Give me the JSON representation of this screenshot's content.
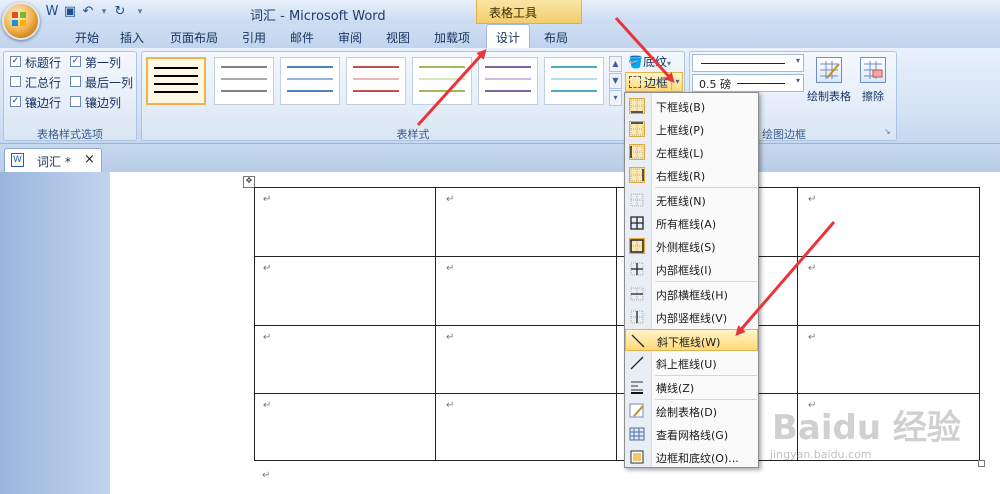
{
  "window": {
    "title": "词汇 - Microsoft Word",
    "context_tab": "表格工具"
  },
  "ribbon_tabs": [
    "开始",
    "插入",
    "页面布局",
    "引用",
    "邮件",
    "审阅",
    "视图",
    "加载项",
    "设计",
    "布局"
  ],
  "active_tab": "设计",
  "table_style_options": {
    "group_title": "表格样式选项",
    "options": [
      {
        "label": "标题行",
        "checked": true
      },
      {
        "label": "第一列",
        "checked": true
      },
      {
        "label": "汇总行",
        "checked": false
      },
      {
        "label": "最后一列",
        "checked": false
      },
      {
        "label": "镶边行",
        "checked": true
      },
      {
        "label": "镶边列",
        "checked": false
      }
    ]
  },
  "table_styles": {
    "group_title": "表样式",
    "shading_label": "底纹",
    "borders_label": "边框",
    "swatch_colors": [
      "#000000",
      "#808080",
      "#4f81bd",
      "#c0504d",
      "#9bbb59",
      "#8064a2",
      "#4bacc6"
    ]
  },
  "draw_borders": {
    "group_title": "绘图边框",
    "line_weight": "0.5 磅",
    "draw_table_label": "绘制表格",
    "eraser_label": "擦除"
  },
  "document": {
    "tab_label": "词汇 *",
    "close": "×",
    "paragraph_mark": "↵"
  },
  "border_menu": {
    "items": [
      {
        "label": "下框线(B)",
        "icon": "bottom-border-icon"
      },
      {
        "label": "上框线(P)",
        "icon": "top-border-icon"
      },
      {
        "label": "左框线(L)",
        "icon": "left-border-icon"
      },
      {
        "label": "右框线(R)",
        "icon": "right-border-icon"
      },
      {
        "label": "无框线(N)",
        "icon": "no-border-icon"
      },
      {
        "label": "所有框线(A)",
        "icon": "all-borders-icon"
      },
      {
        "label": "外侧框线(S)",
        "icon": "outside-borders-icon"
      },
      {
        "label": "内部框线(I)",
        "icon": "inside-borders-icon"
      },
      {
        "label": "内部横框线(H)",
        "icon": "inside-horizontal-border-icon"
      },
      {
        "label": "内部竖框线(V)",
        "icon": "inside-vertical-border-icon"
      },
      {
        "label": "斜下框线(W)",
        "icon": "diagonal-down-border-icon"
      },
      {
        "label": "斜上框线(U)",
        "icon": "diagonal-up-border-icon"
      },
      {
        "label": "横线(Z)",
        "icon": "horizontal-line-icon"
      },
      {
        "label": "绘制表格(D)",
        "icon": "draw-table-icon"
      },
      {
        "label": "查看网格线(G)",
        "icon": "view-gridlines-icon"
      },
      {
        "label": "边框和底纹(O)...",
        "icon": "borders-shading-icon"
      }
    ],
    "highlighted": "斜下框线(W)"
  },
  "watermark": {
    "brand": "Baidu 经验",
    "url": "jingyan.baidu.com"
  },
  "colors": {
    "arrow": "#e8343a",
    "highlight": "#ffd979",
    "tools_tab": "#f3cd6d"
  }
}
